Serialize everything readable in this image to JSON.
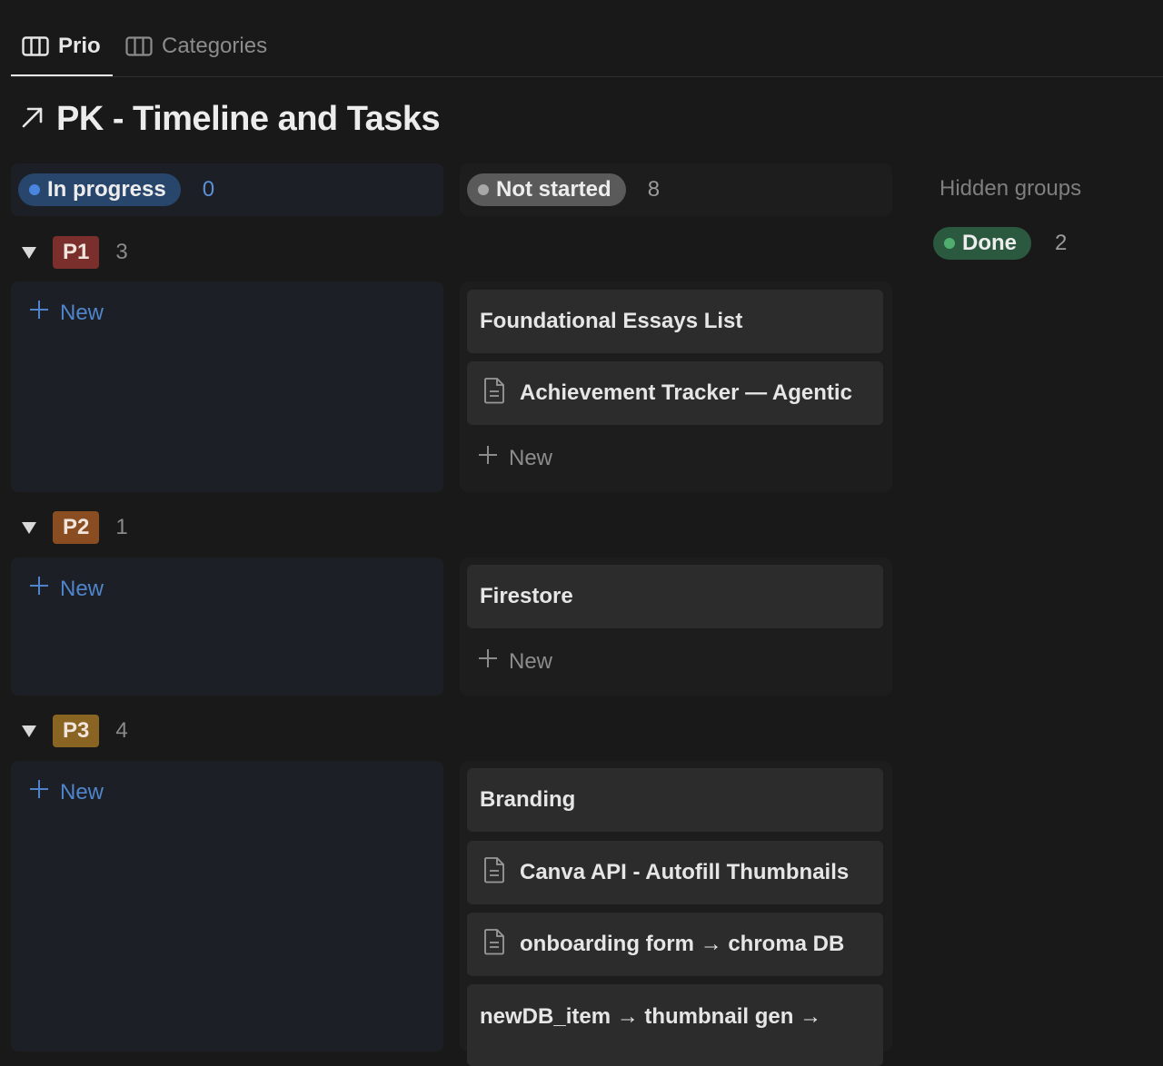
{
  "tabs": [
    {
      "label": "Prio",
      "active": true
    },
    {
      "label": "Categories",
      "active": false
    }
  ],
  "page": {
    "title": "PK - Timeline and Tasks"
  },
  "columns": {
    "in_progress": {
      "label": "In progress",
      "count": "0",
      "color": "#28456c"
    },
    "not_started": {
      "label": "Not started",
      "count": "8",
      "color": "#5a5a5a"
    }
  },
  "hidden_groups": {
    "title": "Hidden groups",
    "done": {
      "label": "Done",
      "count": "2",
      "color": "#2b593f"
    }
  },
  "new_label": "New",
  "groups": [
    {
      "label": "P1",
      "count": "3",
      "color": "#7a2f2c",
      "cards": [
        {
          "title": "Foundational Essays List",
          "icon": ""
        },
        {
          "title": "Achievement Tracker — Agentic",
          "icon": "page-icon"
        }
      ]
    },
    {
      "label": "P2",
      "count": "1",
      "color": "#8a4d22",
      "cards": [
        {
          "title": "Firestore",
          "icon": ""
        }
      ]
    },
    {
      "label": "P3",
      "count": "4",
      "color": "#8a6422",
      "cards": [
        {
          "title": "Branding",
          "icon": ""
        },
        {
          "title": "Canva API - Autofill Thumbnails",
          "icon": "page-icon"
        },
        {
          "title": "onboarding form → chroma DB",
          "icon": "page-icon"
        },
        {
          "title": "newDB_item → thumbnail gen →",
          "icon": ""
        }
      ]
    }
  ]
}
